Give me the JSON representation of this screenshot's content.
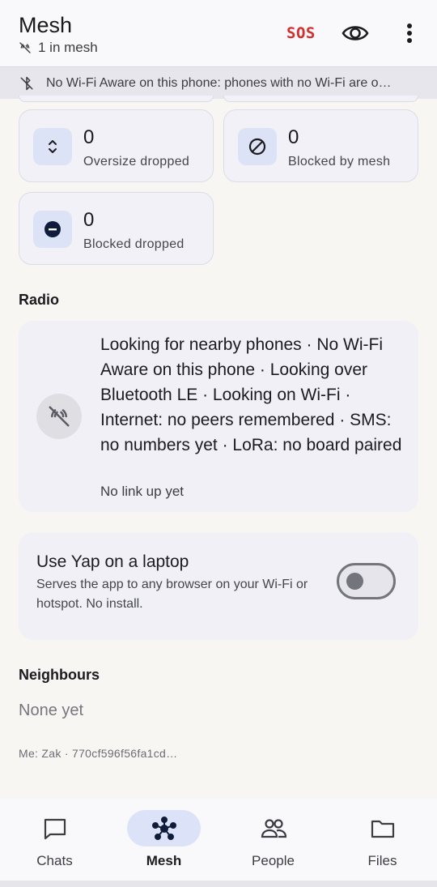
{
  "header": {
    "title": "Mesh",
    "subtitle": "1 in mesh",
    "sos_label": "SOS",
    "icons": [
      "link-off-icon",
      "eye-icon",
      "more-vert-icon"
    ]
  },
  "banner": {
    "text": "No Wi-Fi Aware on this phone: phones with no Wi-Fi are o…",
    "icon": "bluetooth-off-icon"
  },
  "stats": [
    {
      "value": "0",
      "label": "Oversize dropped",
      "icon": "unfold-icon"
    },
    {
      "value": "0",
      "label": "Blocked by mesh",
      "icon": "block-icon"
    },
    {
      "value": "0",
      "label": "Blocked dropped",
      "icon": "minus-circle-icon"
    }
  ],
  "radio": {
    "section_title": "Radio",
    "status": "Looking for nearby phones · No Wi-Fi Aware on this phone · Looking over Bluetooth LE · Looking on Wi-Fi · Internet: no peers remembered · SMS: no numbers yet · LoRa: no board paired",
    "sub": "No link up yet"
  },
  "laptop": {
    "title": "Use Yap on a laptop",
    "description": "Serves the app to any browser on your Wi-Fi or hotspot. No install.",
    "toggle_on": false
  },
  "neighbours": {
    "section_title": "Neighbours",
    "empty_text": "None yet"
  },
  "me_line": "Me: Zak · 770cf596f56fa1cd…",
  "nav": {
    "items": [
      {
        "label": "Chats",
        "icon": "chat-icon",
        "active": false
      },
      {
        "label": "Mesh",
        "icon": "mesh-icon",
        "active": true
      },
      {
        "label": "People",
        "icon": "people-icon",
        "active": false
      },
      {
        "label": "Files",
        "icon": "folder-icon",
        "active": false
      }
    ]
  },
  "colors": {
    "accent_bg": "#dce3f9",
    "sos": "#d32f2f"
  }
}
